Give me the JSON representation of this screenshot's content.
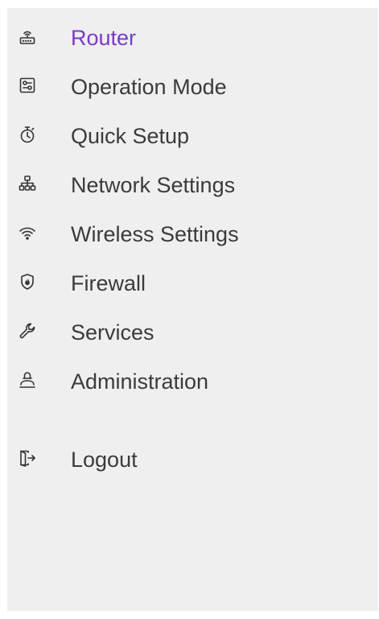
{
  "sidebar": {
    "items": [
      {
        "label": "Router",
        "icon": "router-icon",
        "active": true
      },
      {
        "label": "Operation Mode",
        "icon": "operation-mode-icon",
        "active": false
      },
      {
        "label": "Quick Setup",
        "icon": "stopwatch-icon",
        "active": false
      },
      {
        "label": "Network Settings",
        "icon": "network-icon",
        "active": false
      },
      {
        "label": "Wireless Settings",
        "icon": "wifi-icon",
        "active": false
      },
      {
        "label": "Firewall",
        "icon": "firewall-shield-icon",
        "active": false
      },
      {
        "label": "Services",
        "icon": "wrench-icon",
        "active": false
      },
      {
        "label": "Administration",
        "icon": "admin-user-icon",
        "active": false
      }
    ],
    "logout": {
      "label": "Logout",
      "icon": "logout-icon"
    }
  },
  "colors": {
    "active": "#7a3bc7",
    "text": "#3b3b3b",
    "background": "#efefef"
  }
}
